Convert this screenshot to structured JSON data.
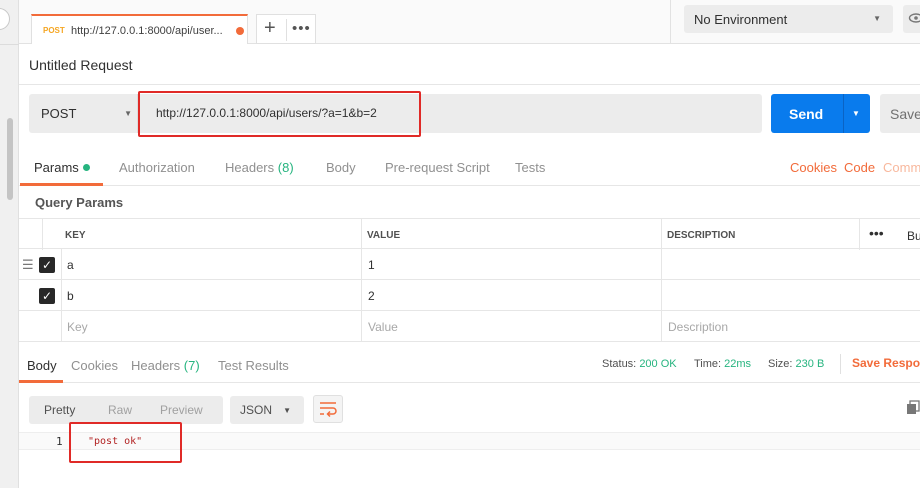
{
  "tab": {
    "method": "POST",
    "url": "http://127.0.0.1:8000/api/user..."
  },
  "tab_actions": {
    "new_tab": "+",
    "more": "•••"
  },
  "environment": {
    "selected": "No Environment"
  },
  "request": {
    "title": "Untitled Request",
    "method": "POST",
    "url": "http://127.0.0.1:8000/api/users/?a=1&b=2",
    "send_label": "Send",
    "save_label": "Save"
  },
  "request_tabs": {
    "params": "Params",
    "authorization": "Authorization",
    "headers": "Headers",
    "headers_count": "(8)",
    "body": "Body",
    "pre_request": "Pre-request Script",
    "tests": "Tests",
    "cookies": "Cookies",
    "code": "Code",
    "comments": "Comm"
  },
  "query_params": {
    "title": "Query Params",
    "columns": {
      "key": "KEY",
      "value": "VALUE",
      "description": "DESCRIPTION",
      "more": "•••",
      "bulk_edit": "Bu"
    },
    "rows": [
      {
        "key": "a",
        "value": "1",
        "description": ""
      },
      {
        "key": "b",
        "value": "2",
        "description": ""
      }
    ],
    "placeholder": {
      "key": "Key",
      "value": "Value",
      "description": "Description"
    }
  },
  "response_tabs": {
    "body": "Body",
    "cookies": "Cookies",
    "headers": "Headers",
    "headers_count": "(7)",
    "test_results": "Test Results"
  },
  "response_status": {
    "status_label": "Status:",
    "status_value": "200 OK",
    "time_label": "Time:",
    "time_value": "22ms",
    "size_label": "Size:",
    "size_value": "230 B",
    "save_response": "Save Respor"
  },
  "response_format": {
    "pretty": "Pretty",
    "raw": "Raw",
    "preview": "Preview",
    "language": "JSON"
  },
  "response_body": {
    "line_number": "1",
    "content": "\"post ok\""
  },
  "colors": {
    "accent": "#f26b3a",
    "send": "#097bed",
    "success": "#26b47f",
    "highlight": "#e02a27"
  }
}
